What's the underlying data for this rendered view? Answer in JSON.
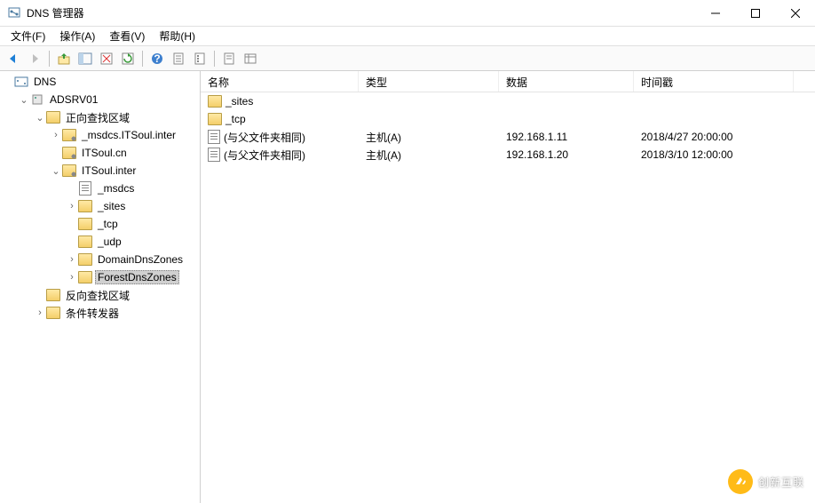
{
  "window": {
    "title": "DNS 管理器"
  },
  "menu": {
    "file": "文件(F)",
    "action": "操作(A)",
    "view": "查看(V)",
    "help": "帮助(H)"
  },
  "tree": {
    "root": "DNS",
    "server": "ADSRV01",
    "fwd_zone_folder": "正向查找区域",
    "zone1": "_msdcs.ITSoul.inter",
    "zone2": "ITSoul.cn",
    "zone3": "ITSoul.inter",
    "child_msdcs": "_msdcs",
    "child_sites": "_sites",
    "child_tcp": "_tcp",
    "child_udp": "_udp",
    "child_domaindns": "DomainDnsZones",
    "child_forestdns": "ForestDnsZones",
    "rev_zone_folder": "反向查找区域",
    "cond_fwd_folder": "条件转发器"
  },
  "list": {
    "headers": {
      "name": "名称",
      "type": "类型",
      "data": "数据",
      "time": "时间戳"
    },
    "rows": [
      {
        "name": "_sites",
        "type": "",
        "data": "",
        "time": "",
        "icon": "folder"
      },
      {
        "name": "_tcp",
        "type": "",
        "data": "",
        "time": "",
        "icon": "folder"
      },
      {
        "name": "(与父文件夹相同)",
        "type": "主机(A)",
        "data": "192.168.1.11",
        "time": "2018/4/27 20:00:00",
        "icon": "doc"
      },
      {
        "name": "(与父文件夹相同)",
        "type": "主机(A)",
        "data": "192.168.1.20",
        "time": "2018/3/10 12:00:00",
        "icon": "doc"
      }
    ]
  },
  "watermark": {
    "text": "创新互联"
  }
}
